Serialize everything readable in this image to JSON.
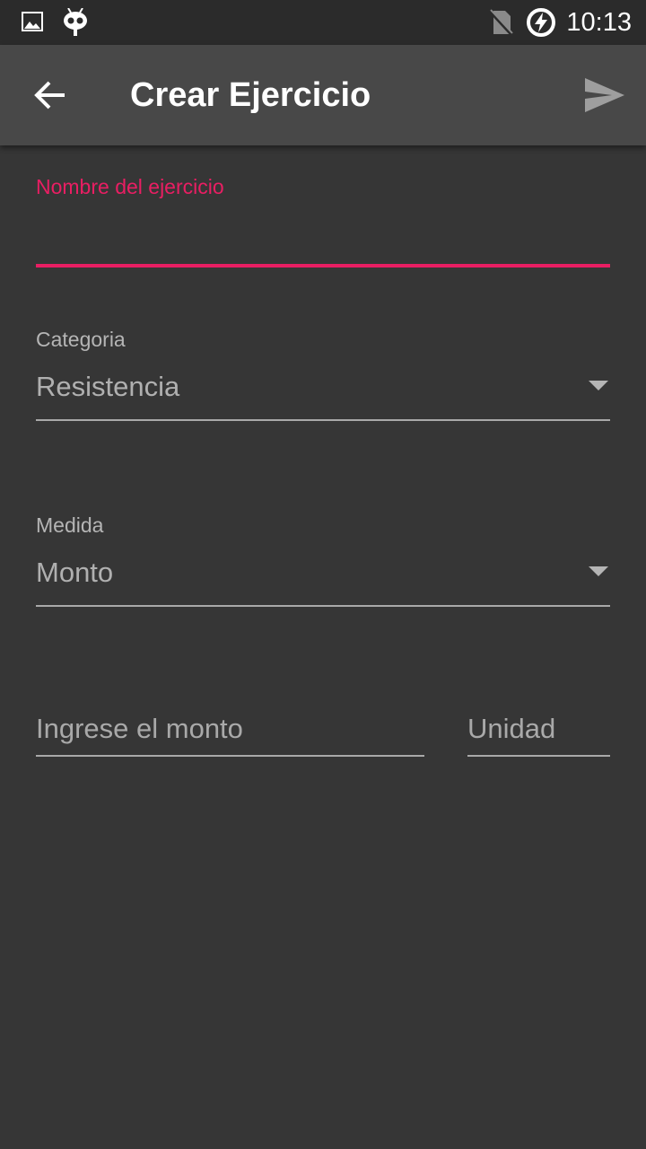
{
  "status_bar": {
    "time": "10:13",
    "icons": [
      "image-icon",
      "cyanogen-mascot-icon",
      "no-sim-icon",
      "battery-charging-icon"
    ]
  },
  "toolbar": {
    "title": "Crear Ejercicio",
    "back_icon": "arrow-back-icon",
    "send_icon": "send-icon"
  },
  "form": {
    "name": {
      "label": "Nombre del ejercicio",
      "value": ""
    },
    "category": {
      "label": "Categoria",
      "selected": "Resistencia"
    },
    "measure": {
      "label": "Medida",
      "selected": "Monto"
    },
    "amount": {
      "placeholder": "Ingrese el monto",
      "value": ""
    },
    "unit": {
      "placeholder": "Unidad",
      "value": ""
    }
  },
  "colors": {
    "accent": "#e91e63",
    "background": "#363636",
    "toolbar": "#484848",
    "status_bar": "#2b2b2b"
  }
}
